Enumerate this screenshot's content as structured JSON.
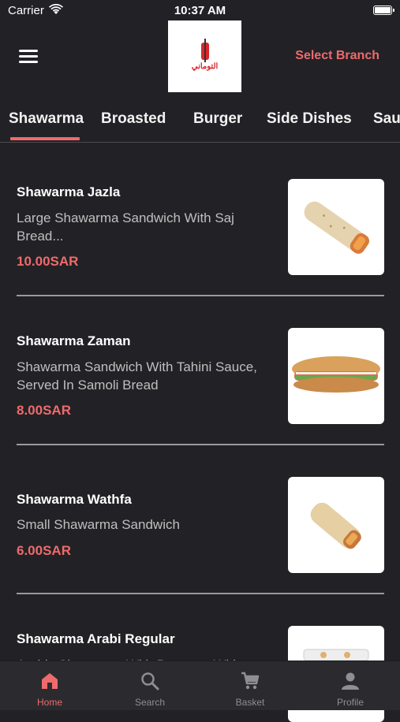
{
  "status": {
    "carrier": "Carrier",
    "time": "10:37 AM"
  },
  "header": {
    "select_branch": "Select Branch",
    "logo_text": "التوماني"
  },
  "tabs": [
    {
      "label": "Shawarma",
      "active": true
    },
    {
      "label": "Broasted"
    },
    {
      "label": "Burger"
    },
    {
      "label": "Side Dishes"
    },
    {
      "label": "Sau"
    }
  ],
  "items": [
    {
      "title": "Shawarma Jazla",
      "desc": "Large Shawarma Sandwich With Saj Bread...",
      "price": "10.00SAR",
      "image_icon": "wrap-image"
    },
    {
      "title": "Shawarma Zaman",
      "desc": "Shawarma Sandwich With Tahini Sauce, Served In Samoli Bread",
      "price": "8.00SAR",
      "image_icon": "sandwich-image"
    },
    {
      "title": "Shawarma Wathfa",
      "desc": "Small Shawarma Sandwich",
      "price": "6.00SAR",
      "image_icon": "small-wrap-image"
    },
    {
      "title": "Shawarma Arabi Regular",
      "desc": "Arabic Shawarma With Potatoes With",
      "price": "",
      "image_icon": "plate-image"
    }
  ],
  "nav": [
    {
      "label": "Home",
      "icon": "home-icon",
      "active": true
    },
    {
      "label": "Search",
      "icon": "search-icon"
    },
    {
      "label": "Basket",
      "icon": "cart-icon"
    },
    {
      "label": "Profile",
      "icon": "profile-icon"
    }
  ],
  "colors": {
    "accent": "#ef6a6c",
    "background": "#222226",
    "nav_bg": "#2b2b2f"
  }
}
